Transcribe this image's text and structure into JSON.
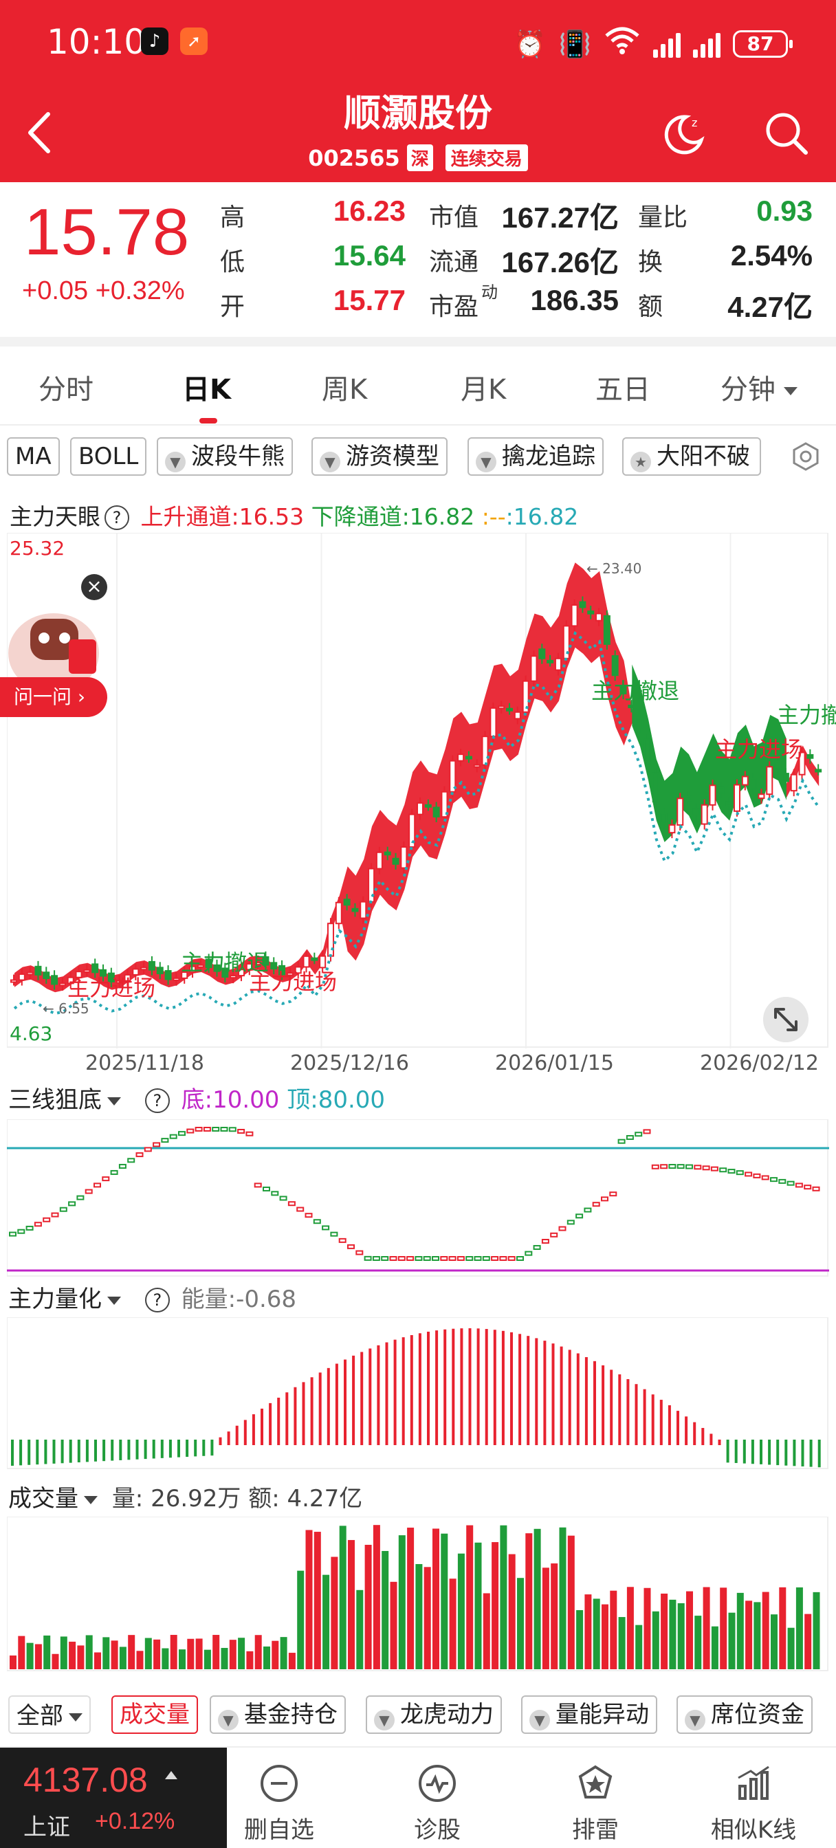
{
  "status_bar": {
    "time": "10:10",
    "battery": "87",
    "network": "6"
  },
  "header": {
    "title": "顺灏股份",
    "code": "002565",
    "exchange_tag": "深",
    "trade_tag": "连续交易"
  },
  "quote": {
    "price": "15.78",
    "change": "+0.05 +0.32%",
    "high_label": "高",
    "high": "16.23",
    "low_label": "低",
    "low": "15.64",
    "open_label": "开",
    "open": "15.77",
    "mktcap_label": "市值",
    "mktcap": "167.27亿",
    "float_label": "流通",
    "float": "167.26亿",
    "pe_label": "市盈",
    "pe_sup": "动",
    "pe": "186.35",
    "volratio_label": "量比",
    "volratio": "0.93",
    "turnover_label": "换",
    "turnover": "2.54%",
    "amount_label": "额",
    "amount": "4.27亿"
  },
  "tabs": [
    "分时",
    "日K",
    "周K",
    "月K",
    "五日",
    "分钟"
  ],
  "active_tab": "日K",
  "indicators": [
    "MA",
    "BOLL",
    "波段牛熊",
    "游资模型",
    "擒龙追踪",
    "大阳不破"
  ],
  "main_info": {
    "name": "主力天眼",
    "help": "?",
    "up_channel": "上升通道:16.53",
    "down_channel": "下降通道:16.82",
    "dash": ":--",
    "value": ":16.82"
  },
  "chart": {
    "y_top": "25.32",
    "y_bottom": "4.63",
    "peak_label": "← 23.40",
    "low_label": "← 6.55",
    "annotations": [
      "主力撤退",
      "主力进场",
      "主力撤退",
      "主力进场",
      "主力撤退",
      "主力进场",
      "主力撤"
    ],
    "dates": [
      "2025/11/18",
      "2025/12/16",
      "2026/01/15",
      "2026/02/12"
    ]
  },
  "robot": {
    "close": "×",
    "ask": "问一问 ›"
  },
  "panel_sanxian": {
    "name": "三线狙底",
    "help": "?",
    "bottom": "底:10.00",
    "top": "顶:80.00"
  },
  "panel_lianghua": {
    "name": "主力量化",
    "help": "?",
    "energy": "能量:-0.68"
  },
  "panel_volume": {
    "name": "成交量",
    "vol": "量: 26.92万",
    "amount": "额: 4.27亿"
  },
  "bottom_selector": {
    "all": "全部",
    "items": [
      "成交量",
      "基金持仓",
      "龙虎动力",
      "量能异动",
      "席位资金"
    ]
  },
  "index": {
    "value": "4137.08",
    "name": "上证",
    "change": "+0.12%"
  },
  "nav": [
    "删自选",
    "诊股",
    "排雷",
    "相似K线"
  ],
  "colors": {
    "brand": "#e8222f",
    "up": "#e8222f",
    "down": "#1f9d3a",
    "teal": "#27a9b5",
    "orange": "#f2a300",
    "magenta": "#c026c8"
  }
}
